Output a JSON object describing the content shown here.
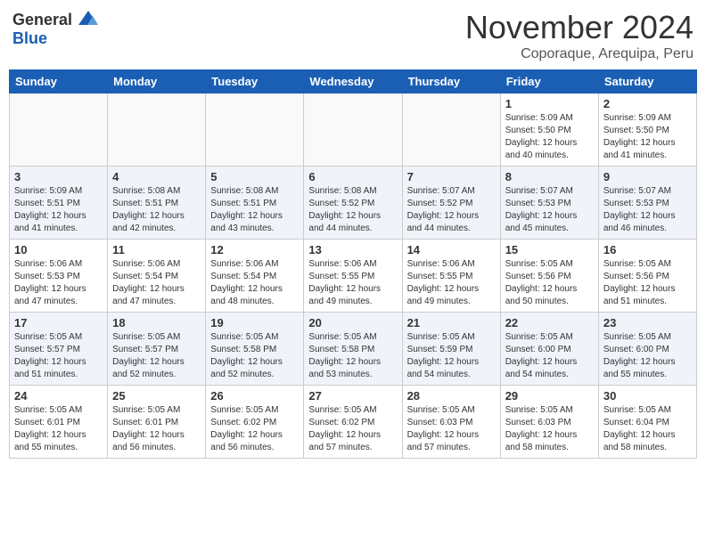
{
  "header": {
    "logo_line1": "General",
    "logo_line2": "Blue",
    "month": "November 2024",
    "location": "Coporaque, Arequipa, Peru"
  },
  "weekdays": [
    "Sunday",
    "Monday",
    "Tuesday",
    "Wednesday",
    "Thursday",
    "Friday",
    "Saturday"
  ],
  "weeks": [
    [
      {
        "day": "",
        "info": ""
      },
      {
        "day": "",
        "info": ""
      },
      {
        "day": "",
        "info": ""
      },
      {
        "day": "",
        "info": ""
      },
      {
        "day": "",
        "info": ""
      },
      {
        "day": "1",
        "info": "Sunrise: 5:09 AM\nSunset: 5:50 PM\nDaylight: 12 hours\nand 40 minutes."
      },
      {
        "day": "2",
        "info": "Sunrise: 5:09 AM\nSunset: 5:50 PM\nDaylight: 12 hours\nand 41 minutes."
      }
    ],
    [
      {
        "day": "3",
        "info": "Sunrise: 5:09 AM\nSunset: 5:51 PM\nDaylight: 12 hours\nand 41 minutes."
      },
      {
        "day": "4",
        "info": "Sunrise: 5:08 AM\nSunset: 5:51 PM\nDaylight: 12 hours\nand 42 minutes."
      },
      {
        "day": "5",
        "info": "Sunrise: 5:08 AM\nSunset: 5:51 PM\nDaylight: 12 hours\nand 43 minutes."
      },
      {
        "day": "6",
        "info": "Sunrise: 5:08 AM\nSunset: 5:52 PM\nDaylight: 12 hours\nand 44 minutes."
      },
      {
        "day": "7",
        "info": "Sunrise: 5:07 AM\nSunset: 5:52 PM\nDaylight: 12 hours\nand 44 minutes."
      },
      {
        "day": "8",
        "info": "Sunrise: 5:07 AM\nSunset: 5:53 PM\nDaylight: 12 hours\nand 45 minutes."
      },
      {
        "day": "9",
        "info": "Sunrise: 5:07 AM\nSunset: 5:53 PM\nDaylight: 12 hours\nand 46 minutes."
      }
    ],
    [
      {
        "day": "10",
        "info": "Sunrise: 5:06 AM\nSunset: 5:53 PM\nDaylight: 12 hours\nand 47 minutes."
      },
      {
        "day": "11",
        "info": "Sunrise: 5:06 AM\nSunset: 5:54 PM\nDaylight: 12 hours\nand 47 minutes."
      },
      {
        "day": "12",
        "info": "Sunrise: 5:06 AM\nSunset: 5:54 PM\nDaylight: 12 hours\nand 48 minutes."
      },
      {
        "day": "13",
        "info": "Sunrise: 5:06 AM\nSunset: 5:55 PM\nDaylight: 12 hours\nand 49 minutes."
      },
      {
        "day": "14",
        "info": "Sunrise: 5:06 AM\nSunset: 5:55 PM\nDaylight: 12 hours\nand 49 minutes."
      },
      {
        "day": "15",
        "info": "Sunrise: 5:05 AM\nSunset: 5:56 PM\nDaylight: 12 hours\nand 50 minutes."
      },
      {
        "day": "16",
        "info": "Sunrise: 5:05 AM\nSunset: 5:56 PM\nDaylight: 12 hours\nand 51 minutes."
      }
    ],
    [
      {
        "day": "17",
        "info": "Sunrise: 5:05 AM\nSunset: 5:57 PM\nDaylight: 12 hours\nand 51 minutes."
      },
      {
        "day": "18",
        "info": "Sunrise: 5:05 AM\nSunset: 5:57 PM\nDaylight: 12 hours\nand 52 minutes."
      },
      {
        "day": "19",
        "info": "Sunrise: 5:05 AM\nSunset: 5:58 PM\nDaylight: 12 hours\nand 52 minutes."
      },
      {
        "day": "20",
        "info": "Sunrise: 5:05 AM\nSunset: 5:58 PM\nDaylight: 12 hours\nand 53 minutes."
      },
      {
        "day": "21",
        "info": "Sunrise: 5:05 AM\nSunset: 5:59 PM\nDaylight: 12 hours\nand 54 minutes."
      },
      {
        "day": "22",
        "info": "Sunrise: 5:05 AM\nSunset: 6:00 PM\nDaylight: 12 hours\nand 54 minutes."
      },
      {
        "day": "23",
        "info": "Sunrise: 5:05 AM\nSunset: 6:00 PM\nDaylight: 12 hours\nand 55 minutes."
      }
    ],
    [
      {
        "day": "24",
        "info": "Sunrise: 5:05 AM\nSunset: 6:01 PM\nDaylight: 12 hours\nand 55 minutes."
      },
      {
        "day": "25",
        "info": "Sunrise: 5:05 AM\nSunset: 6:01 PM\nDaylight: 12 hours\nand 56 minutes."
      },
      {
        "day": "26",
        "info": "Sunrise: 5:05 AM\nSunset: 6:02 PM\nDaylight: 12 hours\nand 56 minutes."
      },
      {
        "day": "27",
        "info": "Sunrise: 5:05 AM\nSunset: 6:02 PM\nDaylight: 12 hours\nand 57 minutes."
      },
      {
        "day": "28",
        "info": "Sunrise: 5:05 AM\nSunset: 6:03 PM\nDaylight: 12 hours\nand 57 minutes."
      },
      {
        "day": "29",
        "info": "Sunrise: 5:05 AM\nSunset: 6:03 PM\nDaylight: 12 hours\nand 58 minutes."
      },
      {
        "day": "30",
        "info": "Sunrise: 5:05 AM\nSunset: 6:04 PM\nDaylight: 12 hours\nand 58 minutes."
      }
    ]
  ]
}
